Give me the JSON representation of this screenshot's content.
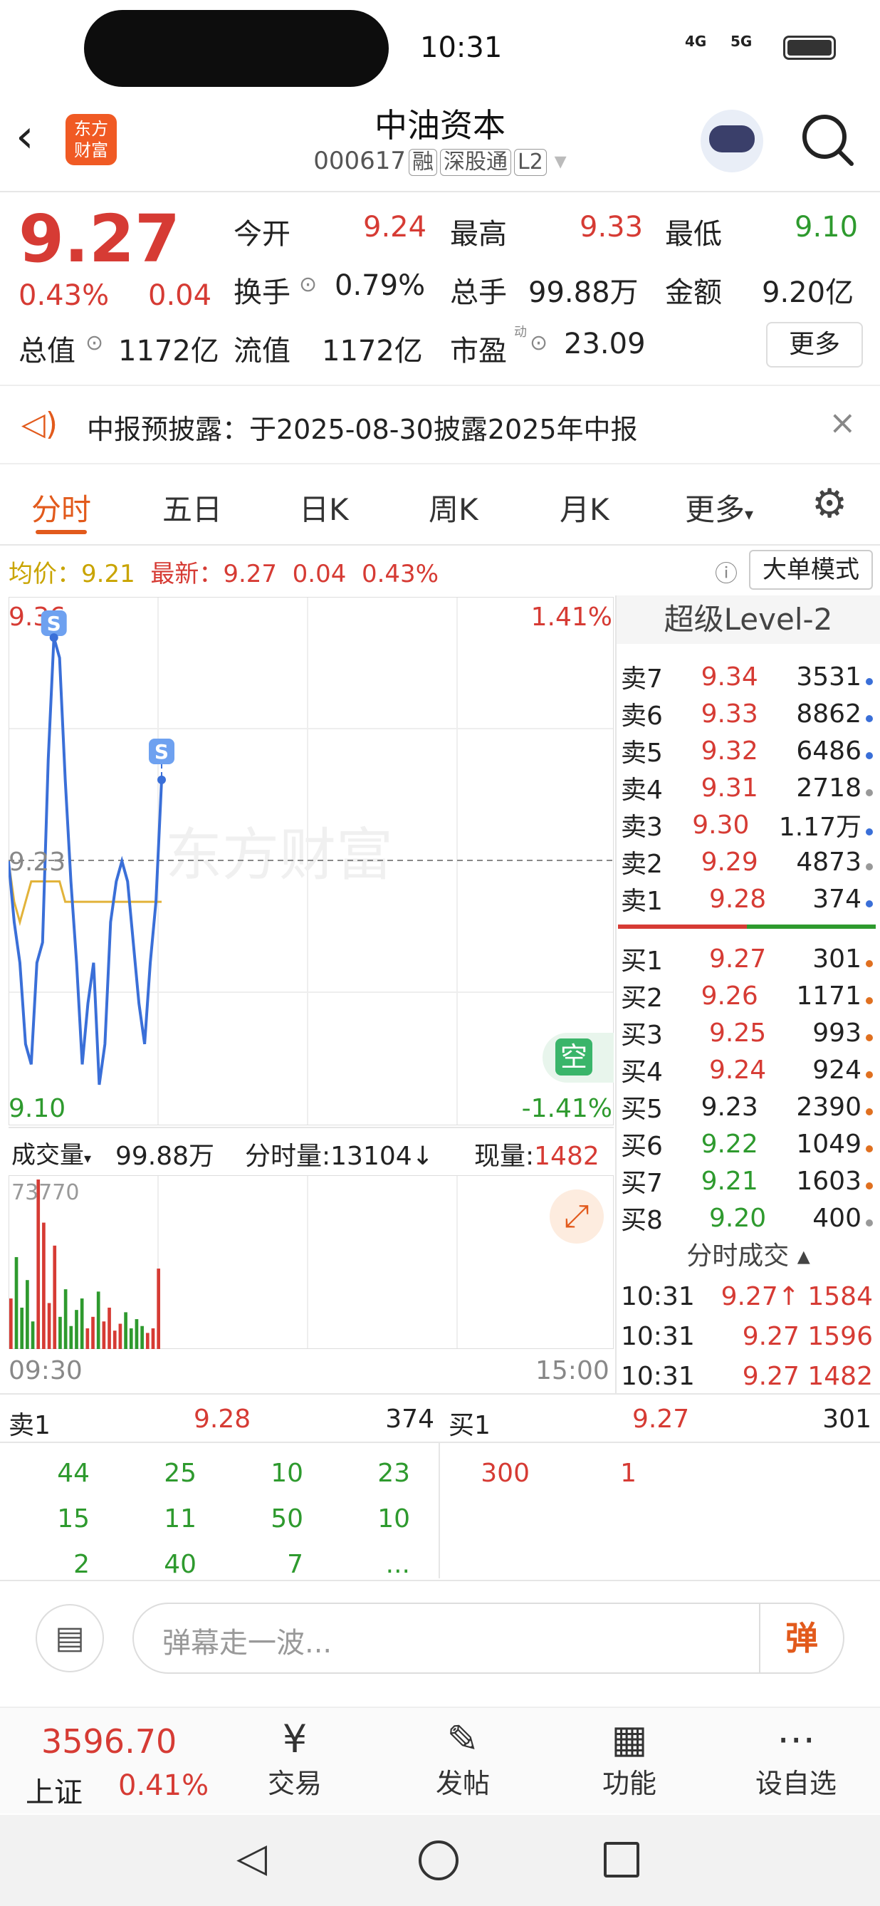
{
  "status": {
    "time": "10:31",
    "network1": "4G",
    "network2": "5G"
  },
  "header": {
    "title": "中油资本",
    "code": "000617",
    "tags": [
      "融",
      "深股通",
      "L2"
    ],
    "logo_line1": "东方",
    "logo_line2": "财富"
  },
  "price": {
    "last": "9.27",
    "pct": "0.43%",
    "change": "0.04"
  },
  "stats": {
    "open_label": "今开",
    "open": "9.24",
    "high_label": "最高",
    "high": "9.33",
    "low_label": "最低",
    "low": "9.10",
    "turnover_label": "换手",
    "turnover": "0.79%",
    "volume_label": "总手",
    "volume": "99.88万",
    "amount_label": "金额",
    "amount": "9.20亿",
    "mktcap_label": "总值",
    "mktcap": "1172亿",
    "float_label": "流值",
    "float": "1172亿",
    "pe_label": "市盈",
    "pe_sup": "动",
    "pe": "23.09",
    "more": "更多"
  },
  "notice": {
    "text": "中报预披露：于2025-08-30披露2025年中报"
  },
  "tabs": [
    "分时",
    "五日",
    "日K",
    "周K",
    "月K",
    "更多"
  ],
  "chart_info": {
    "avg_label": "均价：",
    "avg": "9.21",
    "latest_label": "最新：",
    "latest": "9.27",
    "chg": "0.04",
    "pct": "0.43%",
    "mode": "大单模式"
  },
  "chart_labels": {
    "ymax": "9.36",
    "ymid": "9.23",
    "ymin": "9.10",
    "pmax": "1.41%",
    "pmin": "-1.41%",
    "watermark": "东方财富",
    "empty": "空",
    "s_marker": "S"
  },
  "vol_bar": {
    "label": "成交量",
    "total": "99.88万",
    "tick_label": "分时量:13104",
    "tick_arrow": "↓",
    "now_label": "现量:",
    "now": "1482",
    "vmax": "73770",
    "t_start": "09:30",
    "t_end": "15:00"
  },
  "level2": {
    "title": "超级Level-2",
    "sell": [
      {
        "label": "卖7",
        "price": "9.34",
        "vol": "3531",
        "dot": "#3a6fd8"
      },
      {
        "label": "卖6",
        "price": "9.33",
        "vol": "8862",
        "dot": "#3a6fd8"
      },
      {
        "label": "卖5",
        "price": "9.32",
        "vol": "6486",
        "dot": "#3a6fd8"
      },
      {
        "label": "卖4",
        "price": "9.31",
        "vol": "2718",
        "dot": "#999999"
      },
      {
        "label": "卖3",
        "price": "9.30",
        "vol": "1.17万",
        "dot": "#3a6fd8"
      },
      {
        "label": "卖2",
        "price": "9.29",
        "vol": "4873",
        "dot": "#999999"
      },
      {
        "label": "卖1",
        "price": "9.28",
        "vol": "374",
        "dot": "#3a6fd8"
      }
    ],
    "buy": [
      {
        "label": "买1",
        "price": "9.27",
        "vol": "301",
        "dot": "#e07020",
        "pc": "red"
      },
      {
        "label": "买2",
        "price": "9.26",
        "vol": "1171",
        "dot": "#e07020",
        "pc": "red"
      },
      {
        "label": "买3",
        "price": "9.25",
        "vol": "993",
        "dot": "#e07020",
        "pc": "red"
      },
      {
        "label": "买4",
        "price": "9.24",
        "vol": "924",
        "dot": "#e07020",
        "pc": "red"
      },
      {
        "label": "买5",
        "price": "9.23",
        "vol": "2390",
        "dot": "#e07020",
        "pc": "black"
      },
      {
        "label": "买6",
        "price": "9.22",
        "vol": "1049",
        "dot": "#e07020",
        "pc": "green"
      },
      {
        "label": "买7",
        "price": "9.21",
        "vol": "1603",
        "dot": "#e07020",
        "pc": "green"
      },
      {
        "label": "买8",
        "price": "9.20",
        "vol": "400",
        "dot": "#999999",
        "pc": "green"
      }
    ],
    "trades_title": "分时成交",
    "trades": [
      {
        "time": "10:31",
        "price": "9.27",
        "arrow": "↑",
        "vol": "1584"
      },
      {
        "time": "10:31",
        "price": "9.27",
        "arrow": "",
        "vol": "1596"
      },
      {
        "time": "10:31",
        "price": "9.27",
        "arrow": "",
        "vol": "1482"
      }
    ]
  },
  "queue": {
    "sell_label": "卖1",
    "sell_price": "9.28",
    "sell_vol": "374",
    "buy_label": "买1",
    "buy_price": "9.27",
    "buy_vol": "301",
    "sell_rows": [
      [
        "44",
        "25",
        "10",
        "23"
      ],
      [
        "15",
        "11",
        "50",
        "10"
      ],
      [
        "2",
        "40",
        "7",
        "..."
      ]
    ],
    "buy_rows": [
      [
        "300",
        "1"
      ]
    ]
  },
  "comment": {
    "placeholder": "弹幕走一波...",
    "send": "弹"
  },
  "bottom": {
    "index_value": "3596.70",
    "index_name": "上证",
    "index_pct": "0.41%",
    "items": [
      "交易",
      "发帖",
      "功能",
      "设自选"
    ]
  },
  "chart_data": {
    "type": "line",
    "title": "",
    "ylim": [
      9.1,
      9.36
    ],
    "x_range": [
      "09:30",
      "15:00"
    ],
    "series": [
      {
        "values": [
          9.23,
          9.2,
          9.18,
          9.14,
          9.13,
          9.18,
          9.19,
          9.28,
          9.34,
          9.33,
          9.27,
          9.22,
          9.18,
          9.13,
          9.16,
          9.18,
          9.12,
          9.14,
          9.2,
          9.22,
          9.23,
          9.22,
          9.19,
          9.16,
          9.14,
          9.18,
          9.21,
          9.27
        ]
      },
      {
        "values": [
          9.23,
          9.21,
          9.2,
          9.21,
          9.22,
          9.22,
          9.22,
          9.22,
          9.22,
          9.22,
          9.21,
          9.21,
          9.21,
          9.21,
          9.21,
          9.21,
          9.21,
          9.21,
          9.21,
          9.21,
          9.21,
          9.21,
          9.21,
          9.21,
          9.21,
          9.21,
          9.21,
          9.21
        ]
      }
    ],
    "volume": [
      22000,
      40000,
      18000,
      30000,
      12000,
      73770,
      55000,
      20000,
      45000,
      14000,
      26000,
      10000,
      17000,
      22000,
      9000,
      14000,
      25000,
      12000,
      18000,
      8000,
      11000,
      16000,
      9000,
      13000,
      10000,
      7000,
      9000,
      35000
    ]
  }
}
